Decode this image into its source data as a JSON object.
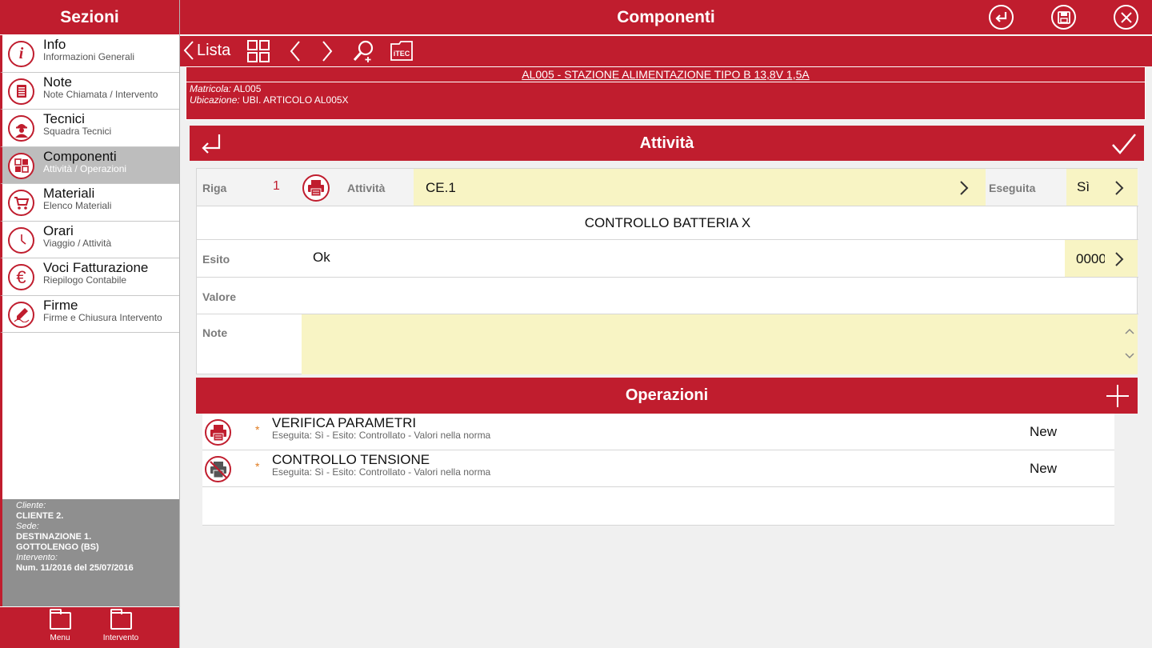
{
  "colors": {
    "accent": "#c01d2e",
    "highlight": "#f8f4c4",
    "client_bg": "#8f8f8f"
  },
  "sidebar": {
    "title": "Sezioni",
    "items": [
      {
        "title": "Info",
        "sub": "Informazioni Generali",
        "icon": "info-icon"
      },
      {
        "title": "Note",
        "sub": "Note Chiamata / Intervento",
        "icon": "notes-icon"
      },
      {
        "title": "Tecnici",
        "sub": "Squadra Tecnici",
        "icon": "technician-icon"
      },
      {
        "title": "Componenti",
        "sub": "Attività / Operazioni",
        "icon": "components-icon"
      },
      {
        "title": "Materiali",
        "sub": "Elenco Materiali",
        "icon": "cart-icon"
      },
      {
        "title": "Orari",
        "sub": "Viaggio / Attività",
        "icon": "clock-icon"
      },
      {
        "title": "Voci Fatturazione",
        "sub": "Riepilogo Contabile",
        "icon": "euro-icon"
      },
      {
        "title": "Firme",
        "sub": "Firme e Chiusura Intervento",
        "icon": "signature-icon"
      }
    ],
    "client": {
      "cliente_label": "Cliente:",
      "cliente": "CLIENTE 2.",
      "sede_label": "Sede:",
      "sede_line1": "DESTINAZIONE 1.",
      "sede_line2": "GOTTOLENGO (BS)",
      "intervento_label": "Intervento:",
      "intervento": "Num. 11/2016 del 25/07/2016"
    },
    "footer": {
      "menu": "Menu",
      "intervento": "Intervento"
    }
  },
  "header": {
    "title": "Componenti"
  },
  "toolbar": {
    "back_label": "Lista"
  },
  "component": {
    "title": "AL005 - STAZIONE ALIMENTAZIONE TIPO B 13,8V 1,5A",
    "matricola_label": "Matricola:",
    "matricola": "AL005",
    "ubicazione_label": "Ubicazione:",
    "ubicazione": "UBI. ARTICOLO AL005X"
  },
  "attivita": {
    "title": "Attività",
    "riga_label": "Riga",
    "riga": "1",
    "attivita_label": "Attività",
    "attivita_value": "CE.1",
    "eseguita_label": "Eseguita",
    "eseguita_value": "Sì",
    "description": "CONTROLLO BATTERIA X",
    "esito_label": "Esito",
    "esito_value": "Ok",
    "esito_code": "0000",
    "valore_label": "Valore",
    "valore_value": "",
    "note_label": "Note",
    "note_value": ""
  },
  "operazioni": {
    "title": "Operazioni",
    "items": [
      {
        "star": "*",
        "name": "VERIFICA PARAMETRI",
        "desc": "Eseguita: Sì - Esito: Controllato - Valori nella norma",
        "status": "New"
      },
      {
        "star": "*",
        "name": "CONTROLLO TENSIONE",
        "desc": "Eseguita: Sì - Esito: Controllato - Valori nella norma",
        "status": "New"
      }
    ]
  }
}
